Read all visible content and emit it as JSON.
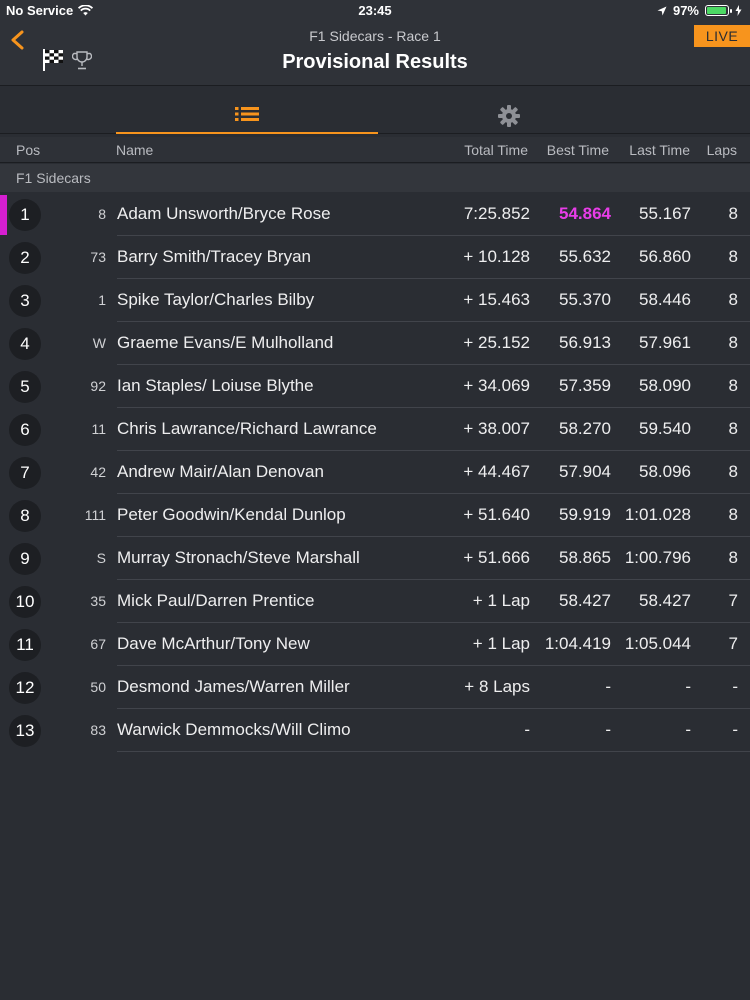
{
  "status_bar": {
    "carrier": "No Service",
    "time": "23:45",
    "battery": "97%",
    "battery_level": 0.97
  },
  "nav": {
    "subtitle": "F1 Sidecars - Race 1",
    "title": "Provisional Results",
    "live_label": "LIVE"
  },
  "tabs": [
    {
      "icon": "list-icon",
      "active": true
    },
    {
      "icon": "gear-icon",
      "active": false
    }
  ],
  "columns": {
    "pos": "Pos",
    "name": "Name",
    "total": "Total Time",
    "best": "Best Time",
    "last": "Last Time",
    "laps": "Laps"
  },
  "section": "F1 Sidecars",
  "colors": {
    "accent": "#f7941d",
    "fastest": "#e83de8",
    "leader_marker": "#d61fd1"
  },
  "results": [
    {
      "pos": "1",
      "num": "8",
      "name": "Adam Unsworth/Bryce Rose",
      "total": "7:25.852",
      "best": "54.864",
      "last": "55.167",
      "laps": "8"
    },
    {
      "pos": "2",
      "num": "73",
      "name": "Barry Smith/Tracey Bryan",
      "total": "+ 10.128",
      "best": "55.632",
      "last": "56.860",
      "laps": "8"
    },
    {
      "pos": "3",
      "num": "1",
      "name": "Spike Taylor/Charles Bilby",
      "total": "+ 15.463",
      "best": "55.370",
      "last": "58.446",
      "laps": "8"
    },
    {
      "pos": "4",
      "num": "W",
      "name": "Graeme Evans/E Mulholland",
      "total": "+ 25.152",
      "best": "56.913",
      "last": "57.961",
      "laps": "8"
    },
    {
      "pos": "5",
      "num": "92",
      "name": "Ian Staples/ Loiuse Blythe",
      "total": "+ 34.069",
      "best": "57.359",
      "last": "58.090",
      "laps": "8"
    },
    {
      "pos": "6",
      "num": "11",
      "name": "Chris Lawrance/Richard Lawrance",
      "total": "+ 38.007",
      "best": "58.270",
      "last": "59.540",
      "laps": "8"
    },
    {
      "pos": "7",
      "num": "42",
      "name": "Andrew Mair/Alan Denovan",
      "total": "+ 44.467",
      "best": "57.904",
      "last": "58.096",
      "laps": "8"
    },
    {
      "pos": "8",
      "num": "111",
      "name": "Peter Goodwin/Kendal Dunlop",
      "total": "+ 51.640",
      "best": "59.919",
      "last": "1:01.028",
      "laps": "8"
    },
    {
      "pos": "9",
      "num": "S",
      "name": "Murray Stronach/Steve Marshall",
      "total": "+ 51.666",
      "best": "58.865",
      "last": "1:00.796",
      "laps": "8"
    },
    {
      "pos": "10",
      "num": "35",
      "name": "Mick Paul/Darren Prentice",
      "total": "+ 1 Lap",
      "best": "58.427",
      "last": "58.427",
      "laps": "7"
    },
    {
      "pos": "11",
      "num": "67",
      "name": "Dave McArthur/Tony New",
      "total": "+ 1 Lap",
      "best": "1:04.419",
      "last": "1:05.044",
      "laps": "7"
    },
    {
      "pos": "12",
      "num": "50",
      "name": "Desmond James/Warren Miller",
      "total": "+ 8 Laps",
      "best": "-",
      "last": "-",
      "laps": "-"
    },
    {
      "pos": "13",
      "num": "83",
      "name": "Warwick Demmocks/Will Climo",
      "total": "-",
      "best": "-",
      "last": "-",
      "laps": "-"
    }
  ]
}
